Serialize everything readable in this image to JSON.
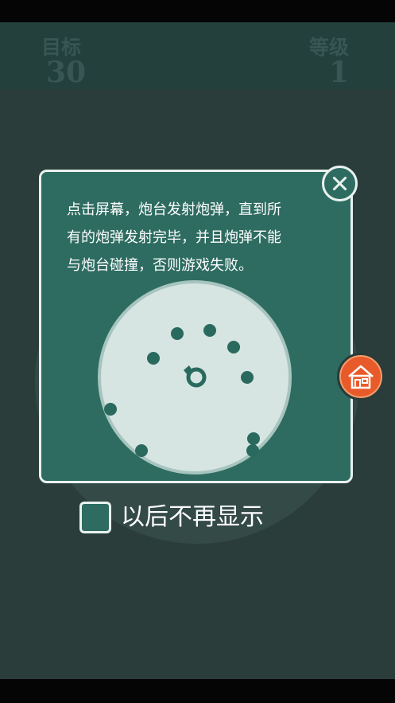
{
  "header": {
    "target_label": "目标",
    "target_value": "30",
    "level_label": "等级",
    "level_value": "1"
  },
  "dialog": {
    "instruction_lines": [
      "点击屏幕，炮台发射炮弹，直到所",
      "有的炮弹发射完毕，并且炮弹不能",
      "与炮台碰撞，否则游戏失败。"
    ],
    "close_icon": "close-icon"
  },
  "home_icon": "house-icon",
  "dont_show_again": {
    "label": "以后不再显示",
    "checked": false
  },
  "colors": {
    "background": "#2b3d3a",
    "dialog": "#2e6c61",
    "home_button": "#e85a2a",
    "ball": "#2a6a5e"
  }
}
